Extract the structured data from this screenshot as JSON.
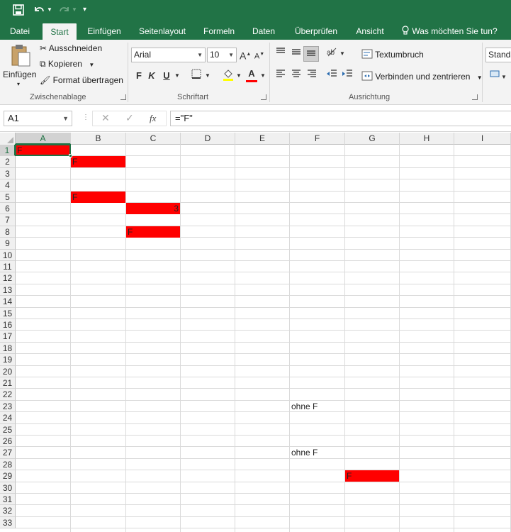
{
  "quick_access": {
    "save_icon": "save-icon",
    "undo_icon": "undo-icon",
    "redo_icon": "redo-icon",
    "customize_icon": "customize-qat-icon"
  },
  "tabs": [
    {
      "label": "Datei",
      "active": false
    },
    {
      "label": "Start",
      "active": true
    },
    {
      "label": "Einfügen",
      "active": false
    },
    {
      "label": "Seitenlayout",
      "active": false
    },
    {
      "label": "Formeln",
      "active": false
    },
    {
      "label": "Daten",
      "active": false
    },
    {
      "label": "Überprüfen",
      "active": false
    },
    {
      "label": "Ansicht",
      "active": false
    }
  ],
  "tell_me": "Was möchten Sie tun?",
  "ribbon": {
    "clipboard": {
      "paste": "Einfügen",
      "cut": "Ausschneiden",
      "copy": "Kopieren",
      "format_painter": "Format übertragen",
      "group_label": "Zwischenablage"
    },
    "font": {
      "font_name": "Arial",
      "font_size": "10",
      "grow": "A",
      "shrink": "A",
      "bold": "F",
      "italic": "K",
      "underline": "U",
      "font_color_letter": "A",
      "group_label": "Schriftart"
    },
    "alignment": {
      "wrap_text": "Textumbruch",
      "merge_center": "Verbinden und zentrieren",
      "group_label": "Ausrichtung"
    },
    "number": {
      "format": "Standa"
    }
  },
  "formula_bar": {
    "name_box": "A1",
    "fx": "fx",
    "formula": "=\"F\""
  },
  "columns": [
    "A",
    "B",
    "C",
    "D",
    "E",
    "F",
    "G",
    "H",
    "I"
  ],
  "rows": [
    "1",
    "2",
    "3",
    "4",
    "5",
    "6",
    "7",
    "8",
    "9",
    "10",
    "11",
    "12",
    "13",
    "14",
    "15",
    "16",
    "17",
    "18",
    "19",
    "20",
    "21",
    "22",
    "23",
    "24",
    "25",
    "26",
    "27",
    "28",
    "29",
    "30",
    "31",
    "32",
    "33"
  ],
  "cells": [
    {
      "ref": "A1",
      "value": "F",
      "fill": "#ff0000",
      "align": "left"
    },
    {
      "ref": "B2",
      "value": "F",
      "fill": "#ff0000",
      "align": "left"
    },
    {
      "ref": "B5",
      "value": "F",
      "fill": "#ff0000",
      "align": "left"
    },
    {
      "ref": "C6",
      "value": "3",
      "fill": "#ff0000",
      "align": "right"
    },
    {
      "ref": "C8",
      "value": "F",
      "fill": "#ff0000",
      "align": "left"
    },
    {
      "ref": "F23",
      "value": "ohne F",
      "fill": "",
      "align": "left"
    },
    {
      "ref": "F27",
      "value": "ohne F",
      "fill": "",
      "align": "left"
    },
    {
      "ref": "G29",
      "value": "F",
      "fill": "#ff0000",
      "align": "left"
    }
  ],
  "active_cell": "A1",
  "colors": {
    "accent": "#217346",
    "highlight": "#ff0000",
    "fill_swatch": "#ffff00",
    "font_color_swatch": "#ff0000"
  }
}
